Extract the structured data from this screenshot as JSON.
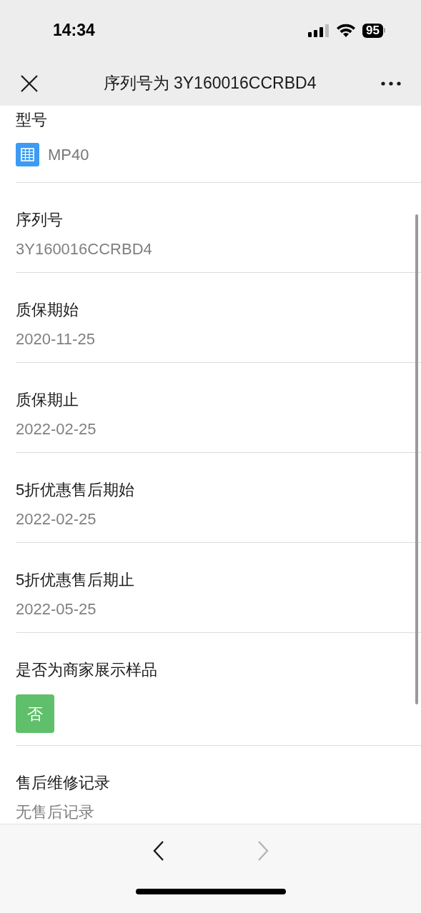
{
  "status_bar": {
    "time": "14:34",
    "battery": "95"
  },
  "nav_bar": {
    "title": "序列号为 3Y160016CCRBD4"
  },
  "fields": [
    {
      "kind": "icon_text",
      "label": "型号",
      "value": "MP40"
    },
    {
      "kind": "text",
      "label": "序列号",
      "value": "3Y160016CCRBD4"
    },
    {
      "kind": "text",
      "label": "质保期始",
      "value": "2020-11-25"
    },
    {
      "kind": "text",
      "label": "质保期止",
      "value": "2022-02-25"
    },
    {
      "kind": "text",
      "label": "5折优惠售后期始",
      "value": "2022-02-25"
    },
    {
      "kind": "text",
      "label": "5折优惠售后期止",
      "value": "2022-05-25"
    },
    {
      "kind": "tag",
      "label": "是否为商家展示样品",
      "value": "否"
    },
    {
      "kind": "text",
      "label": "售后维修记录",
      "value": "无售后记录"
    }
  ],
  "toolbar": {
    "back": {
      "disabled": false
    },
    "forward": {
      "disabled": true
    }
  }
}
